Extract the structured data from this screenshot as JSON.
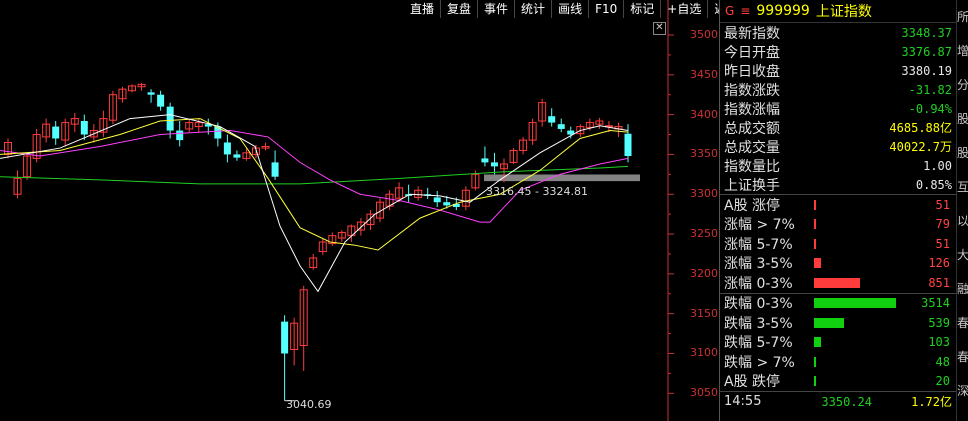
{
  "toolbar": {
    "buttons": [
      "直播",
      "复盘",
      "事件",
      "统计",
      "画线",
      "F10",
      "标记",
      "+自选",
      "返回"
    ]
  },
  "close_glyph": "✕",
  "colors": {
    "up": "#ff3c3c",
    "down": "#54ffff",
    "ma5": "#ffffff",
    "ma10": "#ffff3c",
    "ma20": "#ff40ff",
    "ma60": "#20d020",
    "axis": "#c83232"
  },
  "y_axis": {
    "ticks": [
      "3500",
      "3450",
      "3400",
      "3350",
      "3300",
      "3250",
      "3200",
      "3150",
      "3100",
      "3050"
    ]
  },
  "chart_data": {
    "type": "candlestick",
    "ylim": [
      3040,
      3510
    ],
    "min_label": "3040.69",
    "band_label": "3316.45 - 3324.81",
    "band": [
      3316.45,
      3324.81
    ],
    "candles": [
      [
        3350,
        3370,
        3345,
        3365
      ],
      [
        3300,
        3330,
        3295,
        3320
      ],
      [
        3322,
        3352,
        3318,
        3348
      ],
      [
        3345,
        3382,
        3340,
        3375
      ],
      [
        3372,
        3395,
        3365,
        3388
      ],
      [
        3385,
        3392,
        3362,
        3370
      ],
      [
        3368,
        3395,
        3360,
        3390
      ],
      [
        3388,
        3402,
        3378,
        3395
      ],
      [
        3392,
        3400,
        3368,
        3375
      ],
      [
        3372,
        3388,
        3365,
        3380
      ],
      [
        3378,
        3405,
        3372,
        3395
      ],
      [
        3393,
        3430,
        3388,
        3425
      ],
      [
        3420,
        3435,
        3415,
        3432
      ],
      [
        3430,
        3438,
        3428,
        3436
      ],
      [
        3435,
        3440,
        3430,
        3438
      ],
      [
        3428,
        3432,
        3415,
        3425
      ],
      [
        3425,
        3430,
        3405,
        3410
      ],
      [
        3410,
        3415,
        3370,
        3380
      ],
      [
        3380,
        3392,
        3360,
        3368
      ],
      [
        3382,
        3395,
        3378,
        3390
      ],
      [
        3385,
        3395,
        3378,
        3390
      ],
      [
        3388,
        3395,
        3375,
        3385
      ],
      [
        3385,
        3390,
        3360,
        3370
      ],
      [
        3365,
        3375,
        3340,
        3350
      ],
      [
        3350,
        3355,
        3342,
        3346
      ],
      [
        3345,
        3358,
        3342,
        3352
      ],
      [
        3350,
        3362,
        3345,
        3358
      ],
      [
        3358,
        3365,
        3355,
        3360
      ],
      [
        3340,
        3355,
        3318,
        3322
      ],
      [
        3140,
        3148,
        3040.69,
        3100
      ],
      [
        3105,
        3145,
        3085,
        3138
      ],
      [
        3110,
        3185,
        3078,
        3180
      ],
      [
        3208,
        3225,
        3205,
        3220
      ],
      [
        3228,
        3245,
        3224,
        3240
      ],
      [
        3238,
        3252,
        3235,
        3248
      ],
      [
        3245,
        3255,
        3240,
        3252
      ],
      [
        3248,
        3262,
        3240,
        3260
      ],
      [
        3255,
        3270,
        3248,
        3265
      ],
      [
        3262,
        3280,
        3255,
        3275
      ],
      [
        3270,
        3295,
        3265,
        3290
      ],
      [
        3285,
        3305,
        3280,
        3300
      ],
      [
        3295,
        3315,
        3290,
        3308
      ],
      [
        3300,
        3312,
        3290,
        3298
      ],
      [
        3296,
        3310,
        3292,
        3305
      ],
      [
        3300,
        3308,
        3294,
        3298
      ],
      [
        3296,
        3304,
        3284,
        3290
      ],
      [
        3290,
        3298,
        3282,
        3286
      ],
      [
        3288,
        3296,
        3280,
        3284
      ],
      [
        3285,
        3310,
        3280,
        3305
      ],
      [
        3308,
        3330,
        3305,
        3325
      ],
      [
        3345,
        3360,
        3335,
        3340
      ],
      [
        3340,
        3352,
        3325,
        3335
      ],
      [
        3332,
        3345,
        3315,
        3338
      ],
      [
        3340,
        3358,
        3338,
        3355
      ],
      [
        3355,
        3372,
        3350,
        3368
      ],
      [
        3368,
        3395,
        3362,
        3390
      ],
      [
        3392,
        3420,
        3385,
        3415
      ],
      [
        3398,
        3408,
        3385,
        3390
      ],
      [
        3388,
        3395,
        3378,
        3382
      ],
      [
        3380,
        3385,
        3370,
        3375
      ],
      [
        3376,
        3388,
        3372,
        3385
      ],
      [
        3384,
        3395,
        3380,
        3390
      ],
      [
        3388,
        3396,
        3382,
        3392
      ],
      [
        3385,
        3392,
        3378,
        3386
      ],
      [
        3382,
        3390,
        3372,
        3385
      ],
      [
        3376,
        3388,
        3340,
        3348
      ]
    ],
    "ma5": [
      [
        0,
        3345
      ],
      [
        60,
        3358
      ],
      [
        130,
        3395
      ],
      [
        170,
        3400
      ],
      [
        220,
        3385
      ],
      [
        255,
        3360
      ],
      [
        280,
        3260
      ],
      [
        300,
        3210
      ],
      [
        318,
        3178
      ],
      [
        345,
        3240
      ],
      [
        375,
        3275
      ],
      [
        410,
        3300
      ],
      [
        440,
        3298
      ],
      [
        470,
        3290
      ],
      [
        500,
        3318
      ],
      [
        540,
        3352
      ],
      [
        580,
        3380
      ],
      [
        600,
        3386
      ],
      [
        628,
        3380
      ]
    ],
    "ma10": [
      [
        0,
        3350
      ],
      [
        60,
        3355
      ],
      [
        120,
        3375
      ],
      [
        160,
        3392
      ],
      [
        200,
        3395
      ],
      [
        240,
        3370
      ],
      [
        268,
        3320
      ],
      [
        300,
        3258
      ],
      [
        330,
        3240
      ],
      [
        355,
        3236
      ],
      [
        378,
        3230
      ],
      [
        420,
        3270
      ],
      [
        460,
        3290
      ],
      [
        500,
        3300
      ],
      [
        540,
        3330
      ],
      [
        580,
        3370
      ],
      [
        610,
        3380
      ],
      [
        628,
        3378
      ]
    ],
    "ma20": [
      [
        0,
        3355
      ],
      [
        40,
        3348
      ],
      [
        100,
        3360
      ],
      [
        160,
        3375
      ],
      [
        230,
        3380
      ],
      [
        268,
        3372
      ],
      [
        300,
        3340
      ],
      [
        330,
        3318
      ],
      [
        360,
        3300
      ],
      [
        400,
        3292
      ],
      [
        440,
        3280
      ],
      [
        480,
        3265
      ],
      [
        490,
        3265
      ],
      [
        520,
        3305
      ],
      [
        560,
        3325
      ],
      [
        600,
        3338
      ],
      [
        628,
        3345
      ]
    ],
    "ma60": [
      [
        0,
        3322
      ],
      [
        100,
        3318
      ],
      [
        200,
        3313
      ],
      [
        300,
        3313
      ],
      [
        400,
        3320
      ],
      [
        500,
        3328
      ],
      [
        600,
        3333
      ],
      [
        628,
        3335
      ]
    ]
  },
  "panel": {
    "g_mark": "G",
    "menu_glyph": "≡",
    "code": "999999",
    "name": "上证指数",
    "stats": [
      {
        "label": "最新指数",
        "value": "3348.37",
        "color": "green"
      },
      {
        "label": "今日开盘",
        "value": "3376.87",
        "color": "green"
      },
      {
        "label": "昨日收盘",
        "value": "3380.19",
        "color": "white"
      },
      {
        "label": "指数涨跌",
        "value": "-31.82",
        "color": "green"
      },
      {
        "label": "指数涨幅",
        "value": "-0.94%",
        "color": "green"
      },
      {
        "label": "总成交额",
        "value": "4685.88亿",
        "color": "yellow"
      },
      {
        "label": "总成交量",
        "value": "40022.7万",
        "color": "yellow"
      },
      {
        "label": "指数量比",
        "value": "1.00",
        "color": "white"
      },
      {
        "label": "上证换手",
        "value": "0.85%",
        "color": "white"
      }
    ],
    "breadth_up": [
      {
        "label": "A股 涨停",
        "value": "51",
        "bar": 1
      },
      {
        "label": "涨幅 > 7%",
        "value": "79",
        "bar": 1
      },
      {
        "label": "涨幅 5-7%",
        "value": "51",
        "bar": 1
      },
      {
        "label": "涨幅 3-5%",
        "value": "126",
        "bar": 3
      },
      {
        "label": "涨幅 0-3%",
        "value": "851",
        "bar": 20
      }
    ],
    "breadth_down": [
      {
        "label": "跌幅 0-3%",
        "value": "3514",
        "bar": 82
      },
      {
        "label": "跌幅 3-5%",
        "value": "539",
        "bar": 13
      },
      {
        "label": "跌幅 5-7%",
        "value": "103",
        "bar": 3
      },
      {
        "label": "跌幅 > 7%",
        "value": "48",
        "bar": 1
      },
      {
        "label": "A股 跌停",
        "value": "20",
        "bar": 1
      }
    ],
    "ticks": [
      {
        "time": "14:55",
        "price": "3350.24",
        "vol": "1.72亿"
      }
    ]
  },
  "edge_chars": [
    "所",
    "增",
    "分",
    "股",
    "股",
    "互",
    "以",
    "大",
    "融",
    "春",
    "春",
    "深"
  ]
}
